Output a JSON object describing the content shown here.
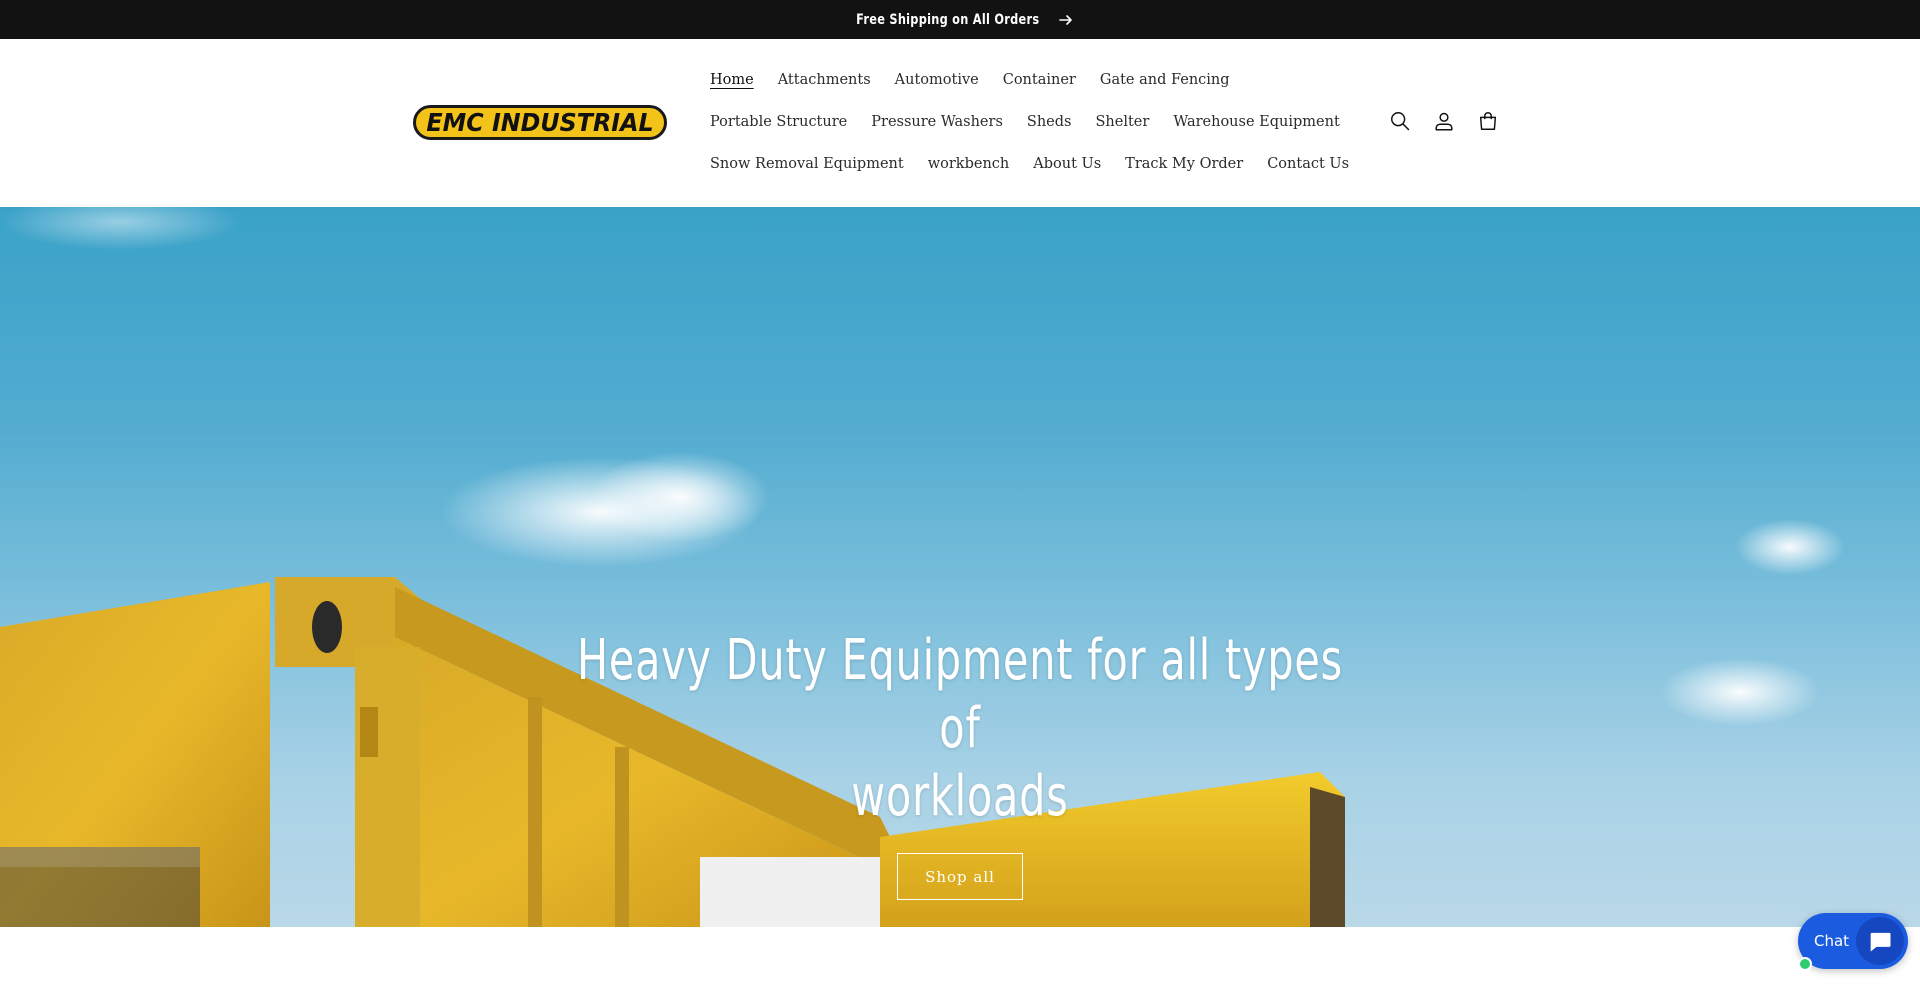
{
  "announcement": {
    "text": "Free Shipping on All Orders"
  },
  "header": {
    "logo_text": "EMC INDUSTRIAL",
    "nav": {
      "row1": [
        "Home",
        "Attachments",
        "Automotive",
        "Container",
        "Gate and Fencing"
      ],
      "row2": [
        "Portable Structure",
        "Pressure Washers",
        "Sheds",
        "Shelter",
        "Warehouse Equipment"
      ],
      "row3": [
        "Snow Removal Equipment",
        "workbench",
        "About Us",
        "Track My Order",
        "Contact Us"
      ]
    },
    "active_item": "Home",
    "icons": [
      "search-icon",
      "account-icon",
      "cart-icon"
    ]
  },
  "hero": {
    "title_line1": "Heavy Duty Equipment for all types of",
    "title_line2": "workloads",
    "button_label": "Shop all"
  },
  "chat": {
    "label": "Chat",
    "accent_color": "#1a5be0",
    "status_color": "#2ecc71"
  },
  "colors": {
    "announcement_bg": "#121212",
    "logo_yellow": "#f3c319",
    "container_yellow": "#e8b82a"
  }
}
